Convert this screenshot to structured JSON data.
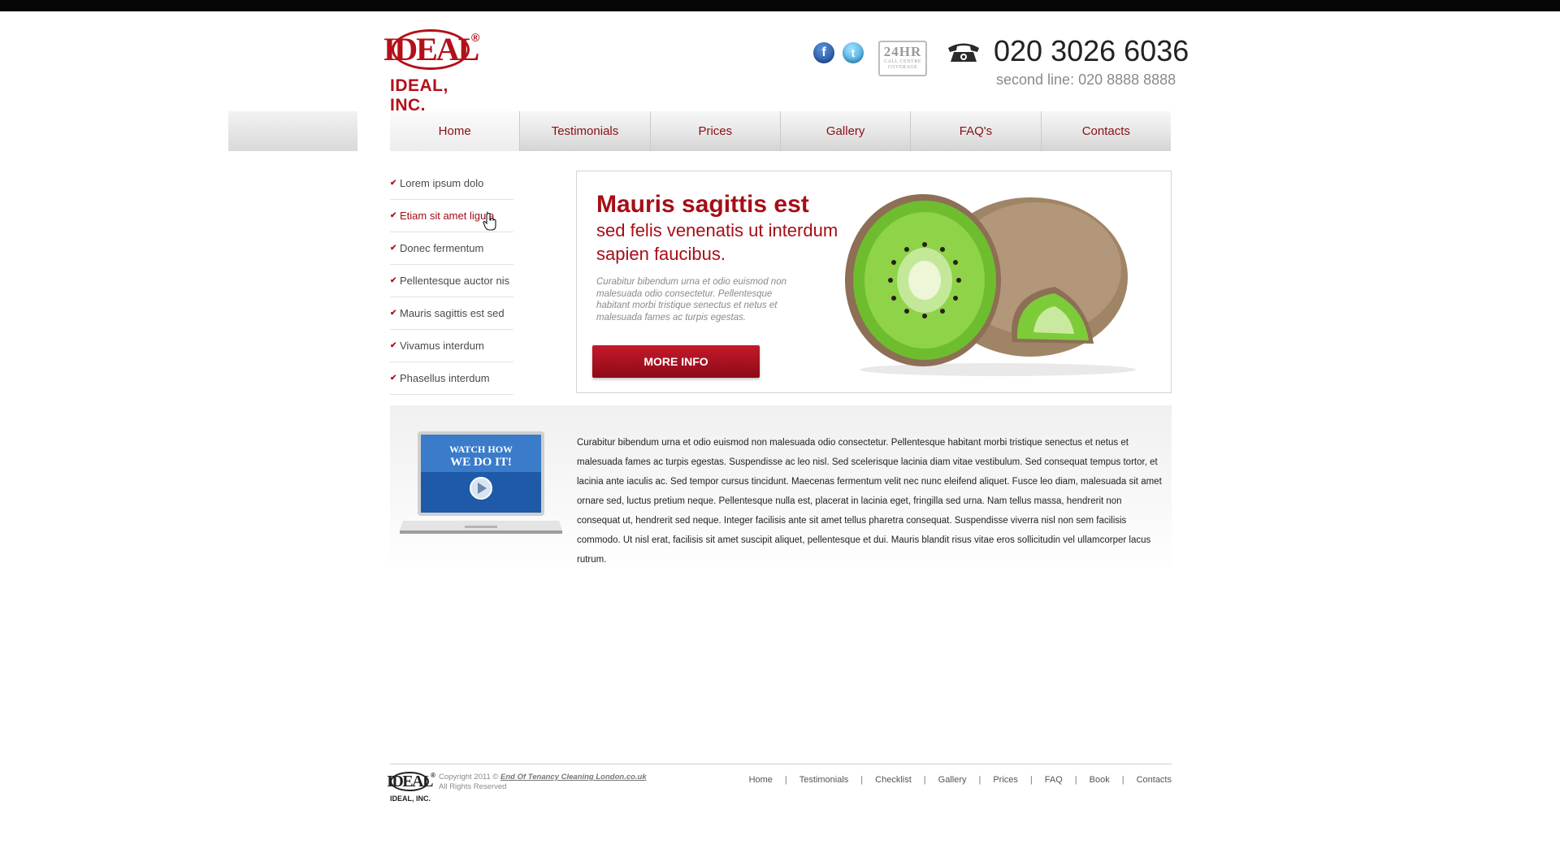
{
  "header": {
    "logo_mark": "IDEAL",
    "logo_reg": "®",
    "logo_name": "IDEAL, INC.",
    "social": {
      "facebook": "f",
      "twitter": "t"
    },
    "badge": {
      "line1": "24HR",
      "line2": "CALL CENTRE",
      "line3": "COVERAGE"
    },
    "phone_number": "020 3026 6036",
    "second_line": "second line: 020 8888 8888"
  },
  "nav": {
    "items": [
      "Home",
      "Testimonials",
      "Prices",
      "Gallery",
      "FAQ's",
      "Contacts"
    ],
    "active": "Home"
  },
  "sidebar": {
    "items": [
      {
        "label": "Lorem ipsum dolo"
      },
      {
        "label": "Etiam sit amet ligula",
        "active": true
      },
      {
        "label": "Donec fermentum"
      },
      {
        "label": "Pellentesque auctor nis"
      },
      {
        "label": "Mauris sagittis est sed"
      },
      {
        "label": "Vivamus interdum"
      },
      {
        "label": "Phasellus interdum"
      }
    ]
  },
  "banner": {
    "title": "Mauris sagittis est",
    "subtitle": "sed felis venenatis ut interdum sapien faucibus.",
    "body": "Curabitur bibendum urna et odio euismod non malesuada odio consectetur. Pellentesque habitant morbi tristique senectus et netus et malesuada fames ac turpis egestas.",
    "button_label": "MORE INFO"
  },
  "video": {
    "line1": "WATCH HOW",
    "line2": "WE DO IT!"
  },
  "content": {
    "text": "Curabitur bibendum urna et odio euismod non malesuada odio consectetur. Pellentesque habitant morbi tristique senectus et netus et malesuada fames ac turpis egestas. Suspendisse ac leo nisl. Sed scelerisque lacinia diam vitae vestibulum. Sed consequat tempus tortor, et lacinia ante iaculis ac. Sed tempor cursus tincidunt. Maecenas fermentum velit nec nunc eleifend aliquet. Fusce leo diam, malesuada sit amet ornare sed, luctus pretium neque. Pellentesque nulla est, placerat in lacinia eget, fringilla sed urna. Nam tellus massa, hendrerit non consequat ut, hendrerit sed neque. Integer facilisis ante sit amet tellus pharetra consequat. Suspendisse viverra nisl non sem facilisis commodo. Ut nisl erat, facilisis sit amet suscipit aliquet, pellentesque et dui. Mauris blandit risus vitae eros sollicitudin vel ullamcorper lacus rutrum."
  },
  "footer": {
    "logo_mark": "IDEAL",
    "logo_reg": "®",
    "logo_name": "IDEAL, INC.",
    "copyright_prefix": "Copyright 2011 ©",
    "copyright_link": "End Of Tenancy Cleaning London.co.uk",
    "rights": "All Rights Reserved",
    "nav": [
      "Home",
      "Testimonials",
      "Checklist",
      "Gallery",
      "Prices",
      "FAQ",
      "Book",
      "Contacts"
    ]
  },
  "colors": {
    "brand_red": "#a60e16",
    "nav_text": "#8b0f14",
    "kiwi_green": "#7ecb3a"
  }
}
